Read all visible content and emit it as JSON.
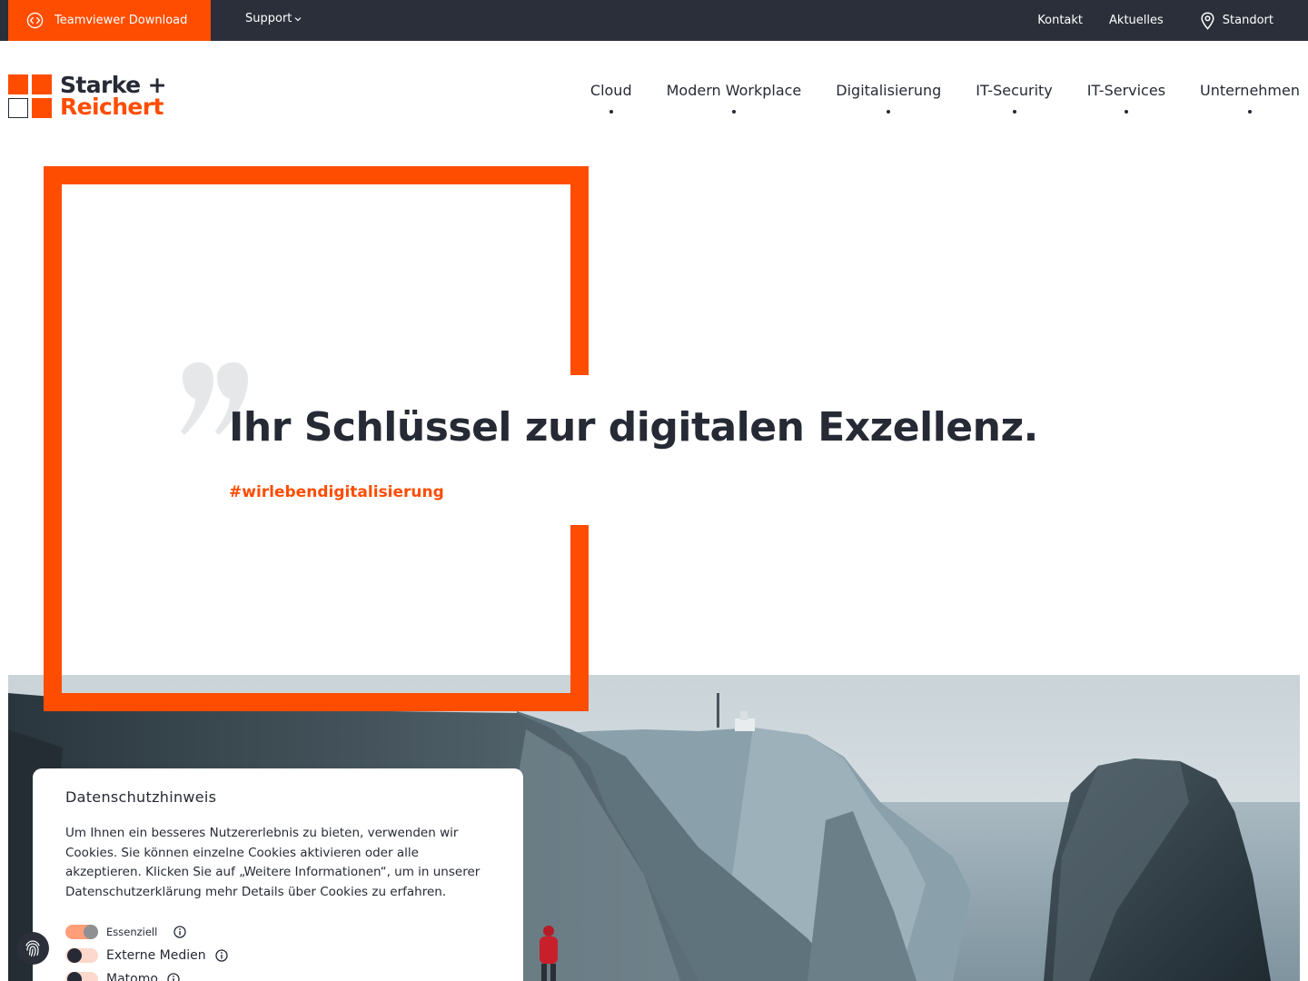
{
  "topbar": {
    "teamviewer_label": "Teamviewer Download",
    "support_label": "Support",
    "links": [
      "Kontakt",
      "Aktuelles"
    ],
    "standort_label": "Standort"
  },
  "brand": {
    "name_line1": "Starke +",
    "name_line2": "Reichert",
    "accent_color": "#ff4d00",
    "dark_color": "#262a35"
  },
  "nav": {
    "items": [
      "Cloud",
      "Modern Workplace",
      "Digitalisierung",
      "IT-Security",
      "IT-Services",
      "Unternehmen"
    ]
  },
  "hero": {
    "headline": "Ihr Schlüssel zur digitalen Exzellenz.",
    "hashtag": "#wirlebendigitalisierung"
  },
  "cookie": {
    "title": "Datenschutzhinweis",
    "text": "Um Ihnen ein besseres Nutzererlebnis zu bieten, verwenden wir Cookies. Sie können einzelne Cookies aktivieren oder alle akzeptieren. Klicken Sie auf „Weitere Informationen“, um in unserer Datenschutzerklärung mehr Details über Cookies zu erfahren.",
    "toggles": [
      {
        "label": "Essenziell",
        "checked": true
      },
      {
        "label": "Externe Medien",
        "checked": false
      },
      {
        "label": "Matomo",
        "checked": false
      }
    ]
  },
  "icons": {
    "teamviewer": "teamviewer-icon",
    "support_chevron": "chevron-down-icon",
    "standort": "map-pin-icon",
    "info": "info-icon",
    "fingerprint": "fingerprint-icon",
    "quote": "quote-icon"
  }
}
